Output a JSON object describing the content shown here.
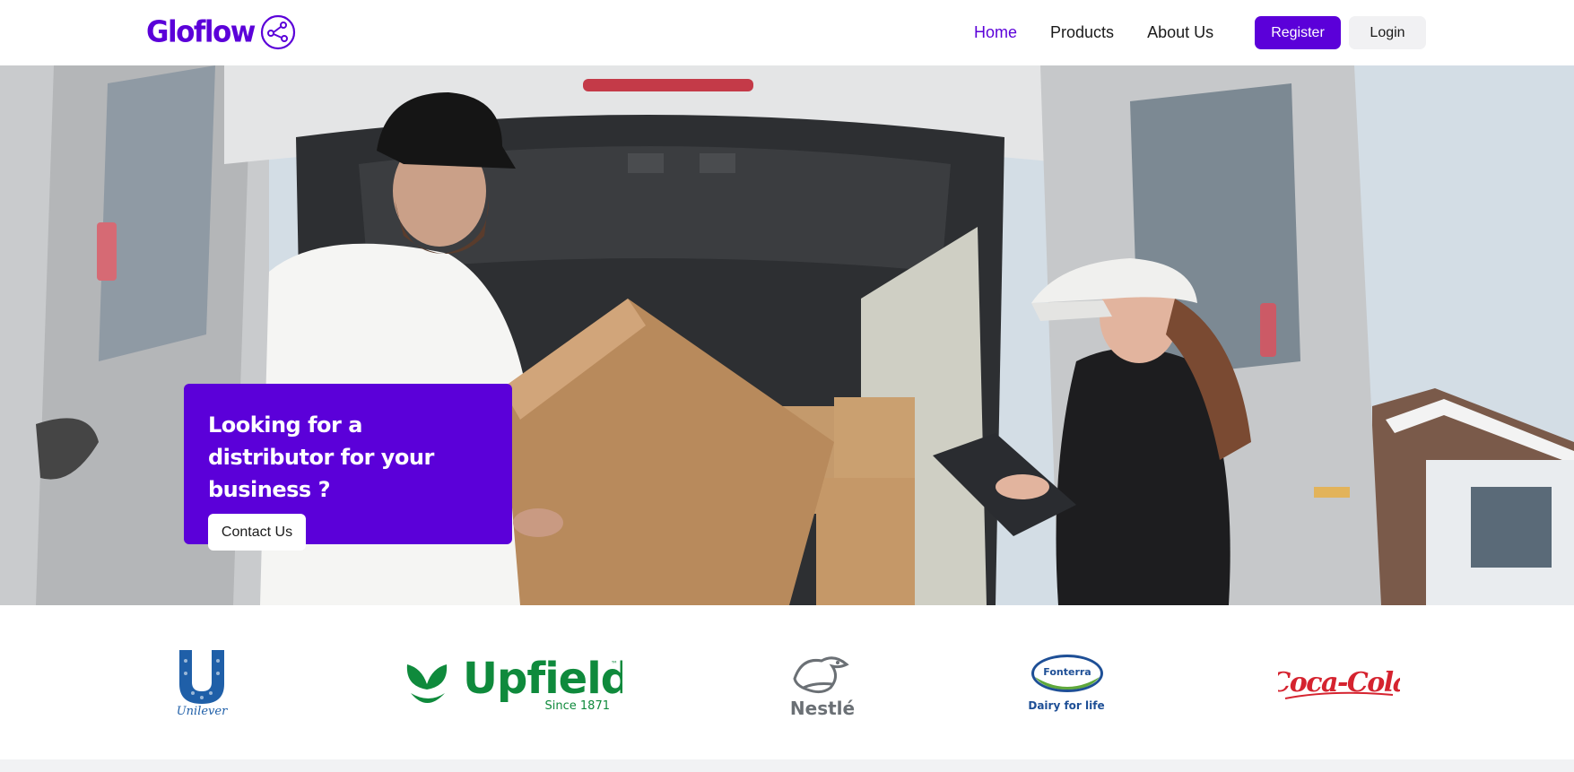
{
  "brand": {
    "name": "Gloflow",
    "accent": "#5b00d9"
  },
  "nav": {
    "links": [
      {
        "label": "Home",
        "active": true
      },
      {
        "label": "Products",
        "active": false
      },
      {
        "label": "About Us",
        "active": false
      }
    ],
    "register_label": "Register",
    "login_label": "Login"
  },
  "hero": {
    "headline": "Looking for a distributor for your business ?",
    "cta_label": "Contact Us"
  },
  "partners": {
    "unilever": {
      "wordmark": "Unilever",
      "icon": "unilever-logo"
    },
    "upfield": {
      "wordmark": "Upfield",
      "tagline": "Since 1871",
      "icon": "upfield-logo"
    },
    "nestle": {
      "wordmark": "Nestlé",
      "icon": "nestle-logo"
    },
    "fonterra": {
      "wordmark": "Fonterra",
      "tagline": "Dairy for life",
      "icon": "fonterra-logo"
    },
    "cocacola": {
      "wordmark": "Coca-Cola",
      "icon": "coca-cola-logo"
    }
  }
}
